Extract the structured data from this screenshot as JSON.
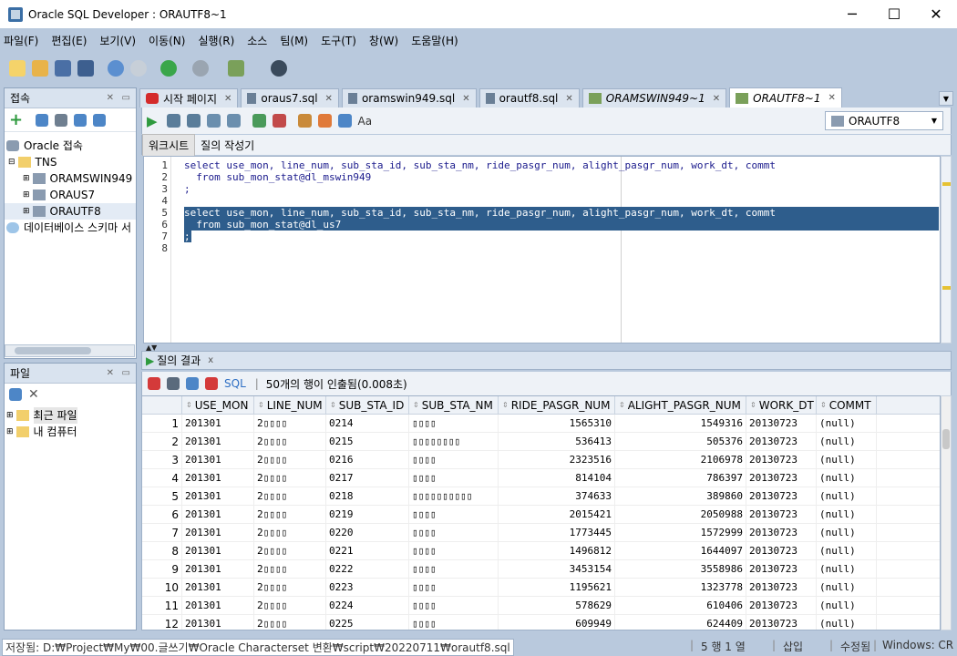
{
  "window": {
    "title": "Oracle SQL Developer : ORAUTF8~1",
    "minimize": "─",
    "maximize": "☐",
    "close": "✕"
  },
  "menu": [
    "파일(F)",
    "편집(E)",
    "보기(V)",
    "이동(N)",
    "실행(R)",
    "소스",
    "팀(M)",
    "도구(T)",
    "창(W)",
    "도움말(H)"
  ],
  "connections_panel": {
    "title": "접속",
    "items": [
      "Oracle 접속",
      "TNS",
      "ORAMSWIN949",
      "ORAUS7",
      "ORAUTF8",
      "데이터베이스 스키마 서"
    ]
  },
  "files_panel": {
    "title": "파일",
    "items": [
      "최근 파일",
      "내 컴퓨터"
    ]
  },
  "editor_tabs": [
    "시작 페이지",
    "oraus7.sql",
    "oramswin949.sql",
    "orautf8.sql",
    "ORAMSWIN949~1",
    "ORAUTF8~1"
  ],
  "connection_select": "ORAUTF8",
  "sub_tabs": [
    "워크시트",
    "질의 작성기"
  ],
  "code_lines": [
    "select use_mon, line_num, sub_sta_id, sub_sta_nm, ride_pasgr_num, alight_pasgr_num, work_dt, commt",
    "  from sub_mon_stat@dl_mswin949",
    ";",
    "",
    "select use_mon, line_num, sub_sta_id, sub_sta_nm, ride_pasgr_num, alight_pasgr_num, work_dt, commt",
    "  from sub_mon_stat@dl_us7",
    ";",
    ""
  ],
  "line_numbers": [
    "1",
    "2",
    "3",
    "4",
    "5",
    "6",
    "7",
    "8"
  ],
  "results": {
    "tab": "질의 결과",
    "tab_close": "x",
    "sql_label": "SQL",
    "message": "50개의 행이 인출됨(0.008초)",
    "columns": [
      "USE_MON",
      "LINE_NUM",
      "SUB_STA_ID",
      "SUB_STA_NM",
      "RIDE_PASGR_NUM",
      "ALIGHT_PASGR_NUM",
      "WORK_DT",
      "COMMT"
    ],
    "rows": [
      [
        "1",
        "201301",
        "2▯▯▯▯",
        "0214",
        "▯▯▯▯",
        "1565310",
        "1549316",
        "20130723",
        "(null)"
      ],
      [
        "2",
        "201301",
        "2▯▯▯▯",
        "0215",
        "▯▯▯▯▯▯▯▯",
        "536413",
        "505376",
        "20130723",
        "(null)"
      ],
      [
        "3",
        "201301",
        "2▯▯▯▯",
        "0216",
        "▯▯▯▯",
        "2323516",
        "2106978",
        "20130723",
        "(null)"
      ],
      [
        "4",
        "201301",
        "2▯▯▯▯",
        "0217",
        "▯▯▯▯",
        "814104",
        "786397",
        "20130723",
        "(null)"
      ],
      [
        "5",
        "201301",
        "2▯▯▯▯",
        "0218",
        "▯▯▯▯▯▯▯▯▯▯",
        "374633",
        "389860",
        "20130723",
        "(null)"
      ],
      [
        "6",
        "201301",
        "2▯▯▯▯",
        "0219",
        "▯▯▯▯",
        "2015421",
        "2050988",
        "20130723",
        "(null)"
      ],
      [
        "7",
        "201301",
        "2▯▯▯▯",
        "0220",
        "▯▯▯▯",
        "1773445",
        "1572999",
        "20130723",
        "(null)"
      ],
      [
        "8",
        "201301",
        "2▯▯▯▯",
        "0221",
        "▯▯▯▯",
        "1496812",
        "1644097",
        "20130723",
        "(null)"
      ],
      [
        "9",
        "201301",
        "2▯▯▯▯",
        "0222",
        "▯▯▯▯",
        "3453154",
        "3558986",
        "20130723",
        "(null)"
      ],
      [
        "10",
        "201301",
        "2▯▯▯▯",
        "0223",
        "▯▯▯▯",
        "1195621",
        "1323778",
        "20130723",
        "(null)"
      ],
      [
        "11",
        "201301",
        "2▯▯▯▯",
        "0224",
        "▯▯▯▯",
        "578629",
        "610406",
        "20130723",
        "(null)"
      ],
      [
        "12",
        "201301",
        "2▯▯▯▯",
        "0225",
        "▯▯▯▯",
        "609949",
        "624409",
        "20130723",
        "(null)"
      ]
    ]
  },
  "status": {
    "path": "저장됨: D:₩Project₩My₩00.글쓰기₩Oracle Characterset 변환₩script₩20220711₩orautf8.sql",
    "position": "5 행 1 열",
    "mode": "삽입",
    "modified": "수정됨",
    "os": "Windows: CR"
  },
  "colors": {
    "accent": "#2e5d8c",
    "chrome": "#b9c9dd",
    "panel_head": "#d9e3ef"
  }
}
